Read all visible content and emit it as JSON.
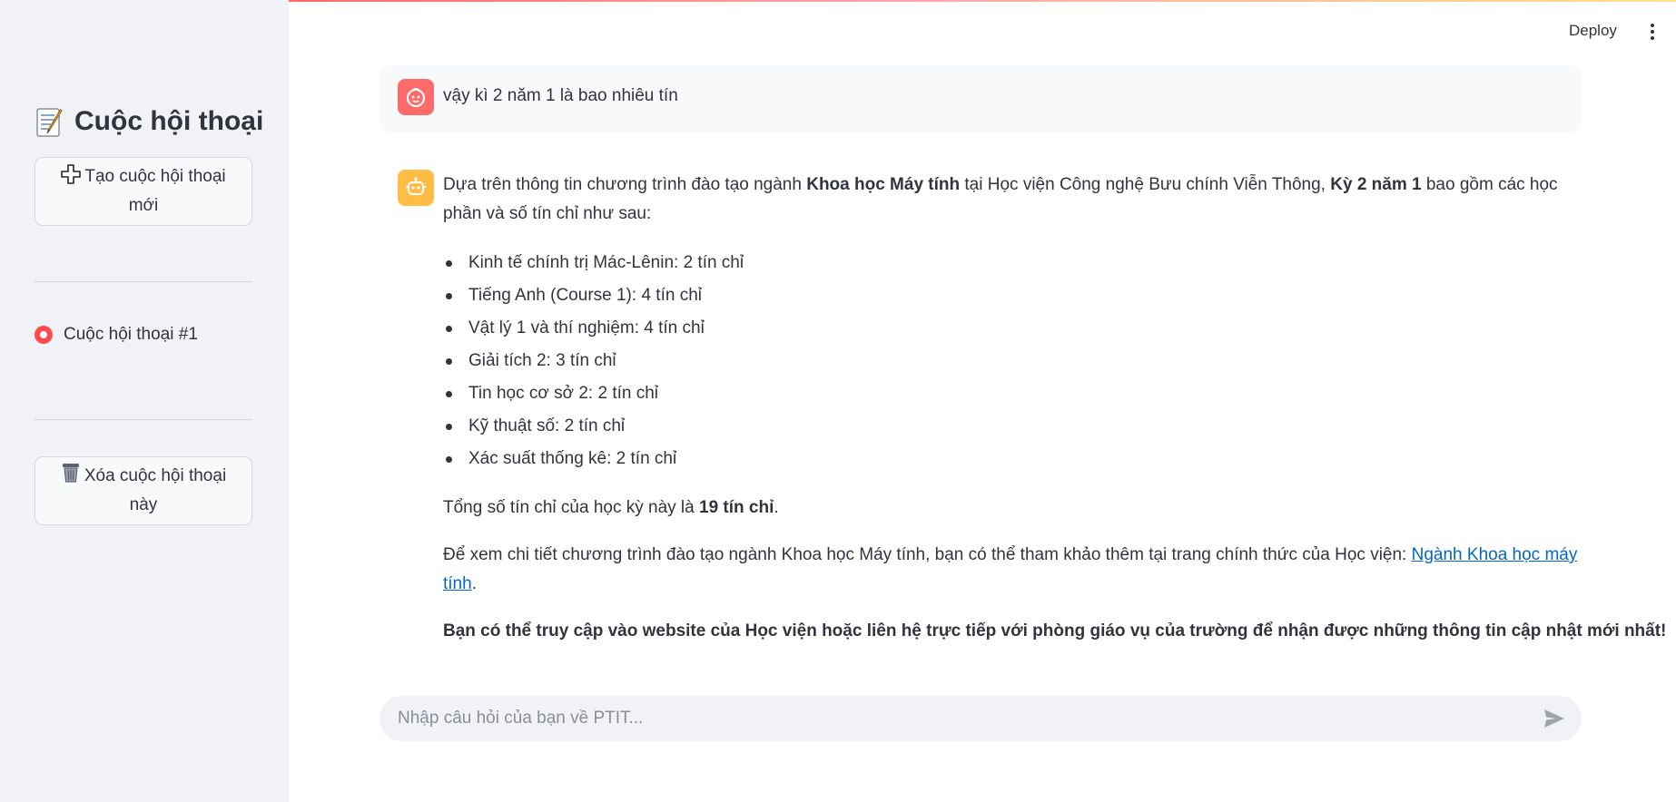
{
  "app": {
    "deploy_label": "Deploy",
    "more_menu_icon": "kebab-menu-icon"
  },
  "sidebar": {
    "title": "Cuộc hội thoại",
    "title_icon": "memo-icon",
    "new_chat_label": "Tạo cuộc hội thoại mới",
    "new_chat_icon": "plus-icon",
    "conversations": [
      {
        "label": "Cuộc hội thoại #1",
        "selected": true
      }
    ],
    "delete_label": "Xóa cuộc hội thoại này",
    "delete_icon": "trash-icon"
  },
  "chat": {
    "user_message": "vậy kì 2 năm 1 là bao nhiêu tín",
    "bot": {
      "intro_pre": "Dựa trên thông tin chương trình đào tạo ngành ",
      "intro_bold1": "Khoa học Máy tính",
      "intro_mid": " tại Học viện Công nghệ Bưu chính Viễn Thông, ",
      "intro_bold2": "Kỳ 2 năm 1",
      "intro_post": " bao gồm các học phần và số tín chỉ như sau:",
      "courses": [
        "Kinh tế chính trị Mác-Lênin: 2 tín chỉ",
        "Tiếng Anh (Course 1): 4 tín chỉ",
        "Vật lý 1 và thí nghiệm: 4 tín chỉ",
        "Giải tích 2: 3 tín chỉ",
        "Tin học cơ sở 2: 2 tín chỉ",
        "Kỹ thuật số: 2 tín chỉ",
        "Xác suất thống kê: 2 tín chỉ"
      ],
      "total_pre": "Tổng số tín chỉ của học kỳ này là ",
      "total_bold": "19 tín chỉ",
      "total_post": ".",
      "detail_pre": "Để xem chi tiết chương trình đào tạo ngành Khoa học Máy tính, bạn có thể tham khảo thêm tại trang chính thức của Học viện: ",
      "detail_link": "Ngành Khoa học máy tính",
      "detail_post": ".",
      "closing": "Bạn có thể truy cập vào website của Học viện hoặc liên hệ trực tiếp với phòng giáo vụ của trường để nhận được những thông tin cập nhật mới nhất!"
    },
    "input_placeholder": "Nhập câu hỏi của bạn về PTIT...",
    "send_icon": "send-icon"
  },
  "colors": {
    "accent": "#ff4b4b",
    "user_avatar": "#ff6b6b",
    "bot_avatar": "#ffbd45",
    "link": "#0068c9",
    "sidebar_bg": "#f0f2f6"
  }
}
